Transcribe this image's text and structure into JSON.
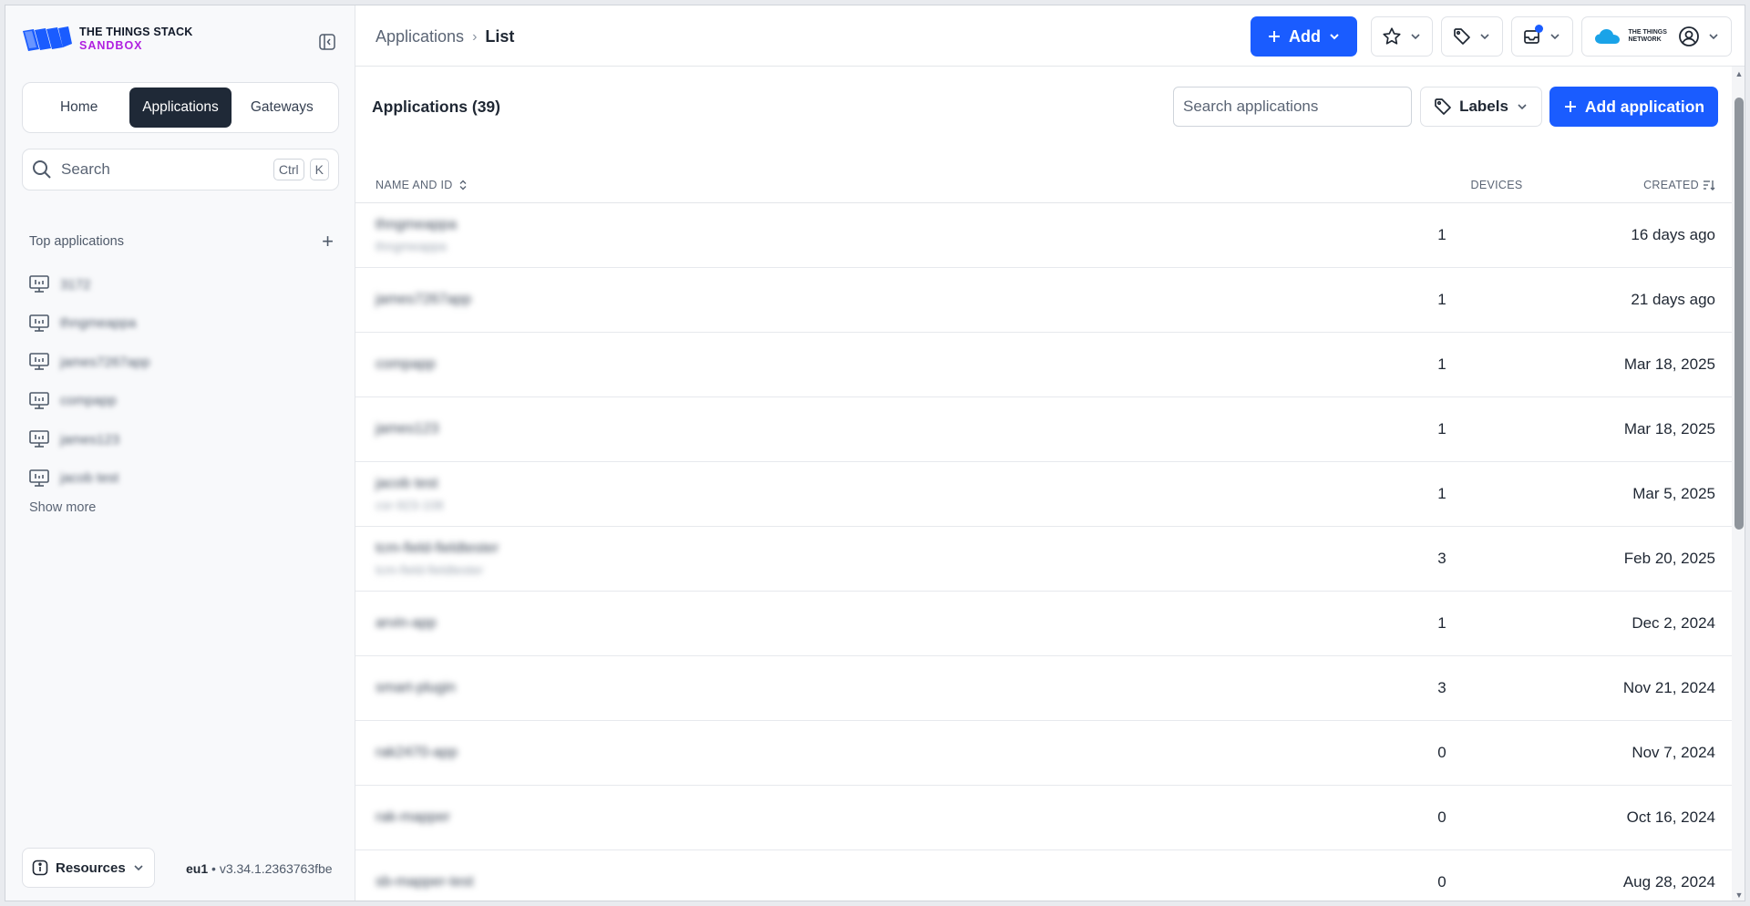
{
  "brand": {
    "line1": "THE THINGS STACK",
    "line2": "SANDBOX",
    "accent": "#b020e0",
    "primary": "#1a5cff"
  },
  "sidebar": {
    "tabs": [
      {
        "label": "Home",
        "active": false
      },
      {
        "label": "Applications",
        "active": true
      },
      {
        "label": "Gateways",
        "active": false
      }
    ],
    "search": {
      "placeholder": "Search",
      "kbd1": "Ctrl",
      "kbd2": "K"
    },
    "top_apps_title": "Top applications",
    "top_apps": [
      "3172",
      "thngmeappa",
      "james7267app",
      "compapp",
      "james123",
      "jacob test"
    ],
    "show_more": "Show more",
    "resources_label": "Resources",
    "version_region": "eu1",
    "version_sep": " • ",
    "version_number": "v3.34.1.2363763fbe"
  },
  "topbar": {
    "breadcrumb_parent": "Applications",
    "breadcrumb_current": "List",
    "add_label": "Add",
    "network_logo_text": "THE THINGS NETWORK"
  },
  "main": {
    "title": "Applications (39)",
    "search_placeholder": "Search applications",
    "labels_button": "Labels",
    "add_application": "Add application",
    "columns": {
      "name": "NAME AND ID",
      "devices": "DEVICES",
      "created": "CREATED"
    },
    "rows": [
      {
        "name": "thngmeappa",
        "id": "thngmeappa",
        "devices": "1",
        "created": "16 days ago"
      },
      {
        "name": "james7267app",
        "id": "",
        "devices": "1",
        "created": "21 days ago"
      },
      {
        "name": "compapp",
        "id": "",
        "devices": "1",
        "created": "Mar 18, 2025"
      },
      {
        "name": "james123",
        "id": "",
        "devices": "1",
        "created": "Mar 18, 2025"
      },
      {
        "name": "jacob test",
        "id": "csr-923-108",
        "devices": "1",
        "created": "Mar 5, 2025"
      },
      {
        "name": "tcm-field-fieldtester",
        "id": "tcm-field-fieldtester",
        "devices": "3",
        "created": "Feb 20, 2025"
      },
      {
        "name": "arvin-app",
        "id": "",
        "devices": "1",
        "created": "Dec 2, 2024"
      },
      {
        "name": "smart-plugin",
        "id": "",
        "devices": "3",
        "created": "Nov 21, 2024"
      },
      {
        "name": "rak2470-app",
        "id": "",
        "devices": "0",
        "created": "Nov 7, 2024"
      },
      {
        "name": "rak-mapper",
        "id": "",
        "devices": "0",
        "created": "Oct 16, 2024"
      },
      {
        "name": "sb-mapper-test",
        "id": "",
        "devices": "0",
        "created": "Aug 28, 2024"
      }
    ]
  }
}
